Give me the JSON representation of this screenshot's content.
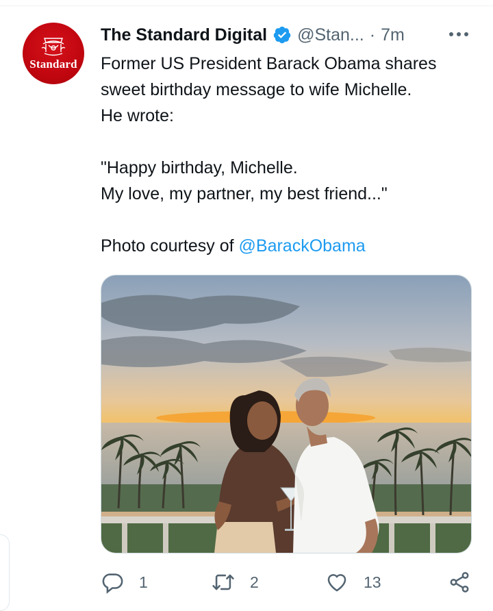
{
  "tweet": {
    "account_logo_text": "Standard",
    "display_name": "The Standard Digital",
    "handle": "@Stan...",
    "separator": "·",
    "time": "7m",
    "body_lines": [
      "Former US President Barack Obama shares",
      "sweet birthday message to wife Michelle.",
      "He wrote:",
      "",
      "\"Happy birthday, Michelle.",
      "My love, my partner, my best friend...\"",
      ""
    ],
    "courtesy_prefix": "Photo courtesy of ",
    "courtesy_mention": "@BarackObama"
  },
  "actions": {
    "reply_count": "1",
    "retweet_count": "2",
    "like_count": "13"
  },
  "icons": {
    "verified": "verified-badge-icon",
    "more": "more-options-icon",
    "reply": "reply-icon",
    "retweet": "retweet-icon",
    "like": "heart-icon",
    "share": "share-icon"
  },
  "colors": {
    "accent": "#1d9bf0",
    "secondary_text": "#536471",
    "avatar_red": "#c1060f"
  }
}
